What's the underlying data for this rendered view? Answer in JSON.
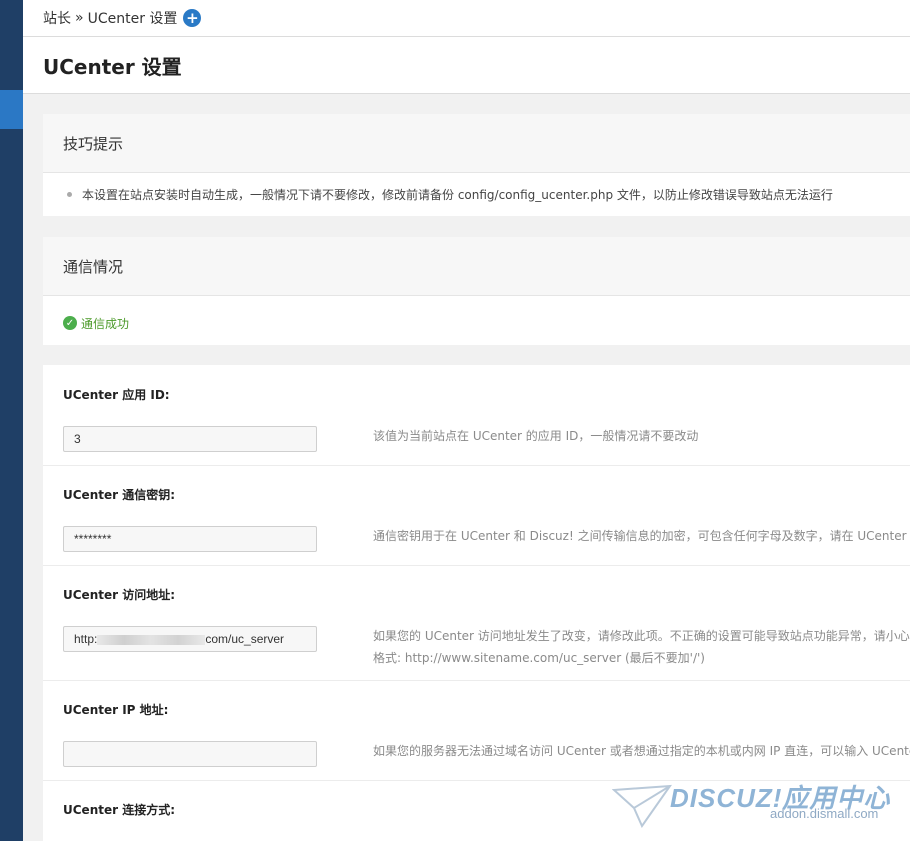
{
  "breadcrumb": {
    "root": "站长",
    "sep": "»",
    "current": "UCenter 设置",
    "add_icon": "plus-circle-icon"
  },
  "page_title": "UCenter 设置",
  "tips": {
    "title": "技巧提示",
    "items": [
      "本设置在站点安装时自动生成，一般情况下请不要修改，修改前请备份 config/config_ucenter.php 文件，以防止修改错误导致站点无法运行"
    ]
  },
  "comm": {
    "title": "通信情况",
    "status_icon": "check-circle-icon",
    "status": "通信成功",
    "status_color": "#4c9a2a"
  },
  "form": {
    "rows": [
      {
        "label": "UCenter 应用 ID:",
        "value": "3",
        "placeholder": "",
        "desc": "该值为当前站点在 UCenter 的应用 ID，一般情况请不要改动",
        "desc2": ""
      },
      {
        "label": "UCenter 通信密钥:",
        "value": "********",
        "placeholder": "",
        "desc": "通信密钥用于在 UCenter 和 Discuz! 之间传输信息的加密，可包含任何字母及数字，请在 UCenter 与",
        "desc2": ""
      },
      {
        "label": "UCenter 访问地址:",
        "value_prefix": "http:",
        "value_suffix": "com/uc_server",
        "placeholder": "",
        "desc": "如果您的 UCenter 访问地址发生了改变，请修改此项。不正确的设置可能导致站点功能异常，请小心",
        "desc2": "格式: http://www.sitename.com/uc_server (最后不要加'/')"
      },
      {
        "label": "UCenter IP 地址:",
        "value": "",
        "placeholder": "",
        "desc": "如果您的服务器无法通过域名访问 UCenter 或者想通过指定的本机或内网 IP 直连，可以输入 UCente",
        "desc2": ""
      },
      {
        "label": "UCenter 连接方式:"
      }
    ]
  },
  "watermark": {
    "logo": "DISCUZ!应用中心",
    "url": "addon.dismall.com"
  },
  "colors": {
    "sidebar": "#1f3f66",
    "sidebar_active": "#2b78c5",
    "accent": "#2a7ac6"
  }
}
